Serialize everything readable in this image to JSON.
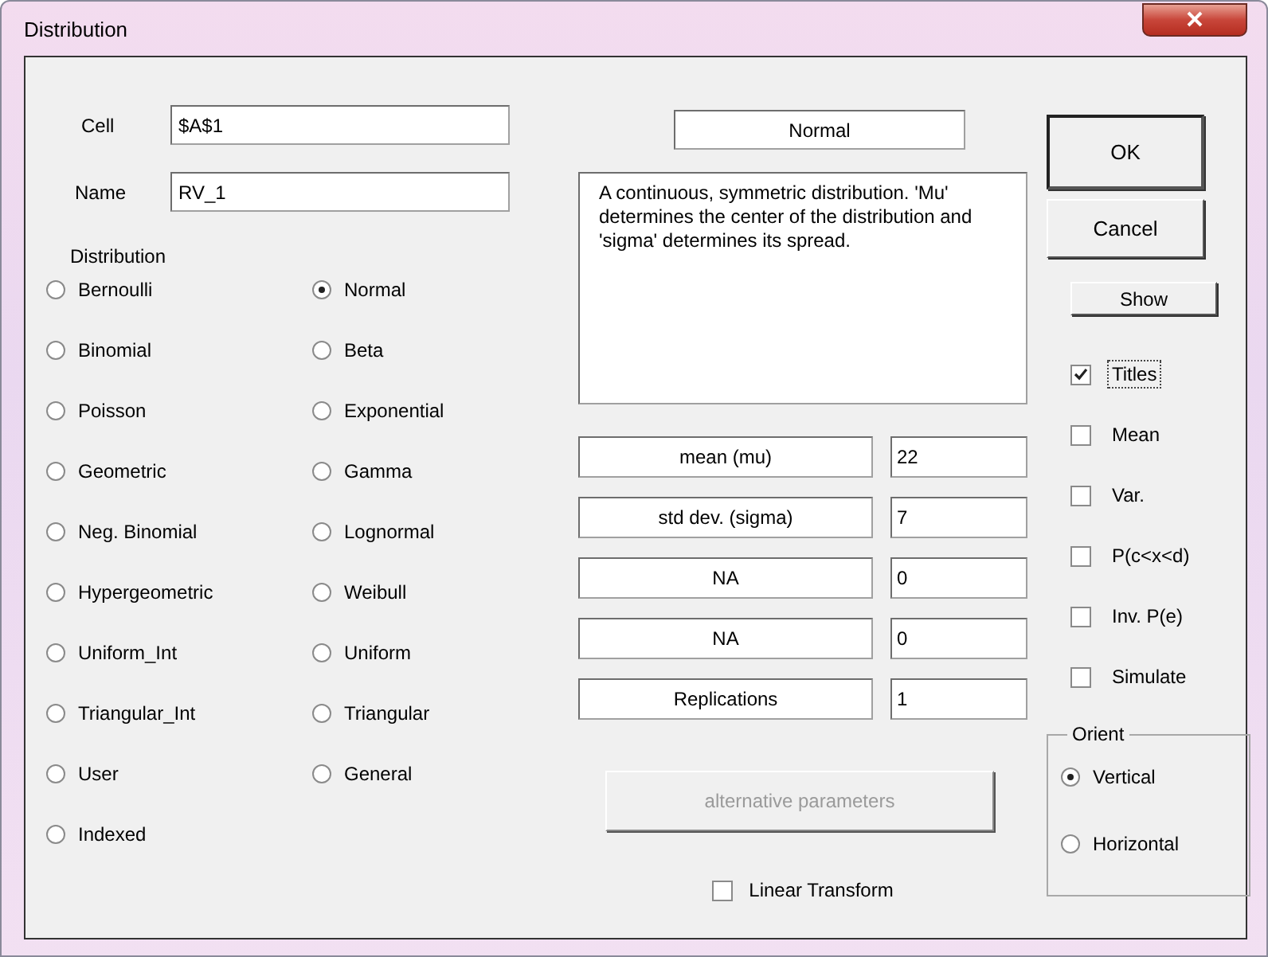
{
  "window": {
    "title": "Distribution"
  },
  "cell": {
    "label": "Cell",
    "value": "$A$1"
  },
  "name": {
    "label": "Name",
    "value": "RV_1"
  },
  "distribution": {
    "label": "Distribution",
    "options": [
      {
        "label": "Bernoulli",
        "selected": false
      },
      {
        "label": "Normal",
        "selected": true
      },
      {
        "label": "Binomial",
        "selected": false
      },
      {
        "label": "Beta",
        "selected": false
      },
      {
        "label": "Poisson",
        "selected": false
      },
      {
        "label": "Exponential",
        "selected": false
      },
      {
        "label": "Geometric",
        "selected": false
      },
      {
        "label": "Gamma",
        "selected": false
      },
      {
        "label": "Neg. Binomial",
        "selected": false
      },
      {
        "label": "Lognormal",
        "selected": false
      },
      {
        "label": "Hypergeometric",
        "selected": false
      },
      {
        "label": "Weibull",
        "selected": false
      },
      {
        "label": "Uniform_Int",
        "selected": false
      },
      {
        "label": "Uniform",
        "selected": false
      },
      {
        "label": "Triangular_Int",
        "selected": false
      },
      {
        "label": "Triangular",
        "selected": false
      },
      {
        "label": "User",
        "selected": false
      },
      {
        "label": "General",
        "selected": false
      },
      {
        "label": "Indexed",
        "selected": false
      }
    ]
  },
  "selected_name": "Normal",
  "description": "A continuous, symmetric distribution. 'Mu' determines the center of the distribution and 'sigma' determines its spread.",
  "parameters": [
    {
      "label": "mean (mu)",
      "value": "22"
    },
    {
      "label": "std dev. (sigma)",
      "value": "7"
    },
    {
      "label": "NA",
      "value": "0"
    },
    {
      "label": "NA",
      "value": "0"
    },
    {
      "label": "Replications",
      "value": "1"
    }
  ],
  "alternative_button": {
    "label": "alternative parameters",
    "disabled": true
  },
  "linear_transform": {
    "label": "Linear Transform",
    "checked": false
  },
  "buttons": {
    "ok": "OK",
    "cancel": "Cancel",
    "show": "Show"
  },
  "show_options": [
    {
      "label": "Titles",
      "checked": true,
      "focused": true
    },
    {
      "label": "Mean",
      "checked": false,
      "focused": false
    },
    {
      "label": "Var.",
      "checked": false,
      "focused": false
    },
    {
      "label": "P(c<x<d)",
      "checked": false,
      "focused": false
    },
    {
      "label": "Inv. P(e)",
      "checked": false,
      "focused": false
    },
    {
      "label": "Simulate",
      "checked": false,
      "focused": false
    }
  ],
  "orient": {
    "label": "Orient",
    "options": [
      {
        "label": "Vertical",
        "selected": true
      },
      {
        "label": "Horizontal",
        "selected": false
      }
    ]
  }
}
